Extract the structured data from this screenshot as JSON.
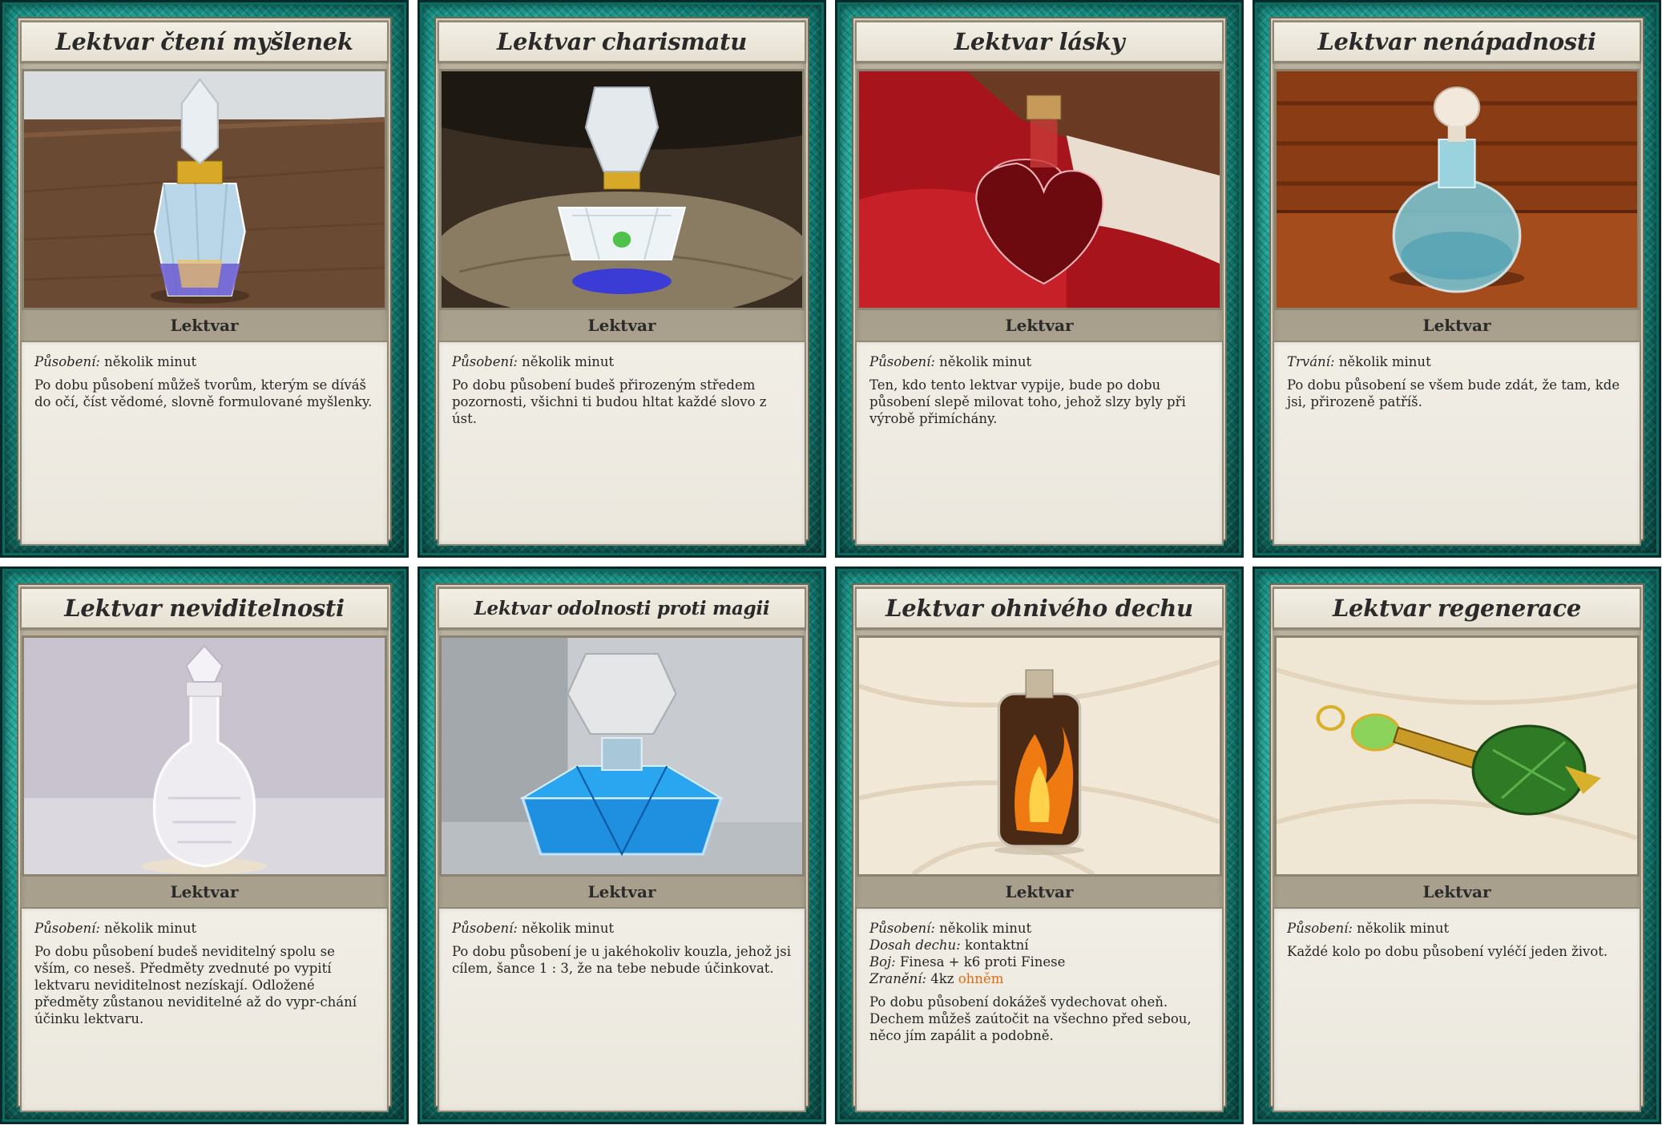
{
  "cards": [
    {
      "title": "Lektvar čtení myšlenek",
      "type": "Lektvar",
      "stats": [
        {
          "label": "Působení:",
          "value": "několik minut"
        }
      ],
      "description": "Po dobu působení můžeš tvorům, kterým se díváš do očí, číst vědomé, slovně formulované myšlenky."
    },
    {
      "title": "Lektvar charismatu",
      "type": "Lektvar",
      "stats": [
        {
          "label": "Působení:",
          "value": "několik minut"
        }
      ],
      "description": "Po dobu působení budeš přirozeným středem pozornosti, všichni ti budou hltat každé slovo z úst."
    },
    {
      "title": "Lektvar lásky",
      "type": "Lektvar",
      "stats": [
        {
          "label": "Působení:",
          "value": "několik minut"
        }
      ],
      "description": "Ten, kdo tento lektvar vypije, bude po dobu působení slepě milovat toho, jehož slzy byly při výrobě přimíchány."
    },
    {
      "title": "Lektvar nenápadnosti",
      "type": "Lektvar",
      "stats": [
        {
          "label": "Trvání:",
          "value": "několik minut"
        }
      ],
      "description": "Po dobu působení se všem bude zdát, že tam, kde jsi, přirozeně patříš."
    },
    {
      "title": "Lektvar neviditelnosti",
      "type": "Lektvar",
      "stats": [
        {
          "label": "Působení:",
          "value": "několik minut"
        }
      ],
      "description": "Po dobu působení budeš neviditelný spolu se vším, co neseš. Předměty zvednuté po vypití lektvaru neviditelnost nezískají. Odložené předměty zůstanou neviditelné až do vypr-chání účinku lektvaru."
    },
    {
      "title": "Lektvar odolnosti proti magii",
      "type": "Lektvar",
      "stats": [
        {
          "label": "Působení:",
          "value": "několik minut"
        }
      ],
      "description": "Po dobu působení je u jakéhokoliv kouzla, jehož jsi cílem, šance 1 : 3, že na tebe nebude účinkovat."
    },
    {
      "title": "Lektvar ohnivého dechu",
      "type": "Lektvar",
      "stats": [
        {
          "label": "Působení:",
          "value": "několik minut"
        },
        {
          "label": "Dosah dechu:",
          "value": "kontaktní"
        },
        {
          "label": "Boj:",
          "value": "Finesa + k6 proti Finese"
        },
        {
          "label": "Zranění:",
          "value": "4kz",
          "highlight": "ohněm"
        }
      ],
      "description": "Po dobu působení dokážeš vydechovat oheň. Dechem můžeš zaútočit na všechno před sebou, něco jím zapálit a podobně."
    },
    {
      "title": "Lektvar regenerace",
      "type": "Lektvar",
      "stats": [
        {
          "label": "Působení:",
          "value": "několik minut"
        }
      ],
      "description": "Každé kolo po dobu působení vyléčí jeden život."
    }
  ],
  "colors": {
    "border_teal": "#12897d",
    "frame_stone": "#b2aa97",
    "parchment": "#efebe2",
    "fire_text": "#e06a12"
  }
}
